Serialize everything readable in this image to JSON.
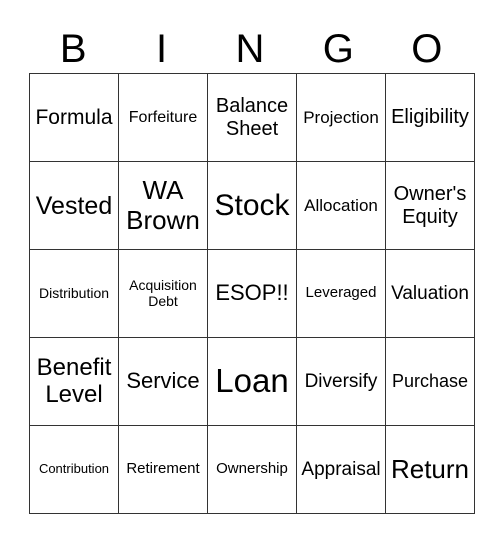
{
  "header": [
    "B",
    "I",
    "N",
    "G",
    "O"
  ],
  "rows": [
    [
      {
        "lines": [
          "Formula"
        ],
        "size": 21
      },
      {
        "lines": [
          "Forfeiture"
        ],
        "size": 16
      },
      {
        "lines": [
          "Balance",
          "Sheet"
        ],
        "size": 20
      },
      {
        "lines": [
          "Projection"
        ],
        "size": 17
      },
      {
        "lines": [
          "Eligibility"
        ],
        "size": 20
      }
    ],
    [
      {
        "lines": [
          "Vested"
        ],
        "size": 25
      },
      {
        "lines": [
          "WA",
          "Brown"
        ],
        "size": 26
      },
      {
        "lines": [
          "Stock"
        ],
        "size": 30
      },
      {
        "lines": [
          "Allocation"
        ],
        "size": 17
      },
      {
        "lines": [
          "Owner's",
          "Equity"
        ],
        "size": 20
      }
    ],
    [
      {
        "lines": [
          "Distribution"
        ],
        "size": 14
      },
      {
        "lines": [
          "Acquisition",
          "Debt"
        ],
        "size": 14
      },
      {
        "lines": [
          "ESOP!!"
        ],
        "size": 22
      },
      {
        "lines": [
          "Leveraged"
        ],
        "size": 15
      },
      {
        "lines": [
          "Valuation"
        ],
        "size": 19
      }
    ],
    [
      {
        "lines": [
          "Benefit",
          "Level"
        ],
        "size": 24
      },
      {
        "lines": [
          "Service"
        ],
        "size": 22
      },
      {
        "lines": [
          "Loan"
        ],
        "size": 33
      },
      {
        "lines": [
          "Diversify"
        ],
        "size": 19
      },
      {
        "lines": [
          "Purchase"
        ],
        "size": 18
      }
    ],
    [
      {
        "lines": [
          "Contribution"
        ],
        "size": 13
      },
      {
        "lines": [
          "Retirement"
        ],
        "size": 15
      },
      {
        "lines": [
          "Ownership"
        ],
        "size": 15
      },
      {
        "lines": [
          "Appraisal"
        ],
        "size": 19
      },
      {
        "lines": [
          "Return"
        ],
        "size": 26
      }
    ]
  ]
}
